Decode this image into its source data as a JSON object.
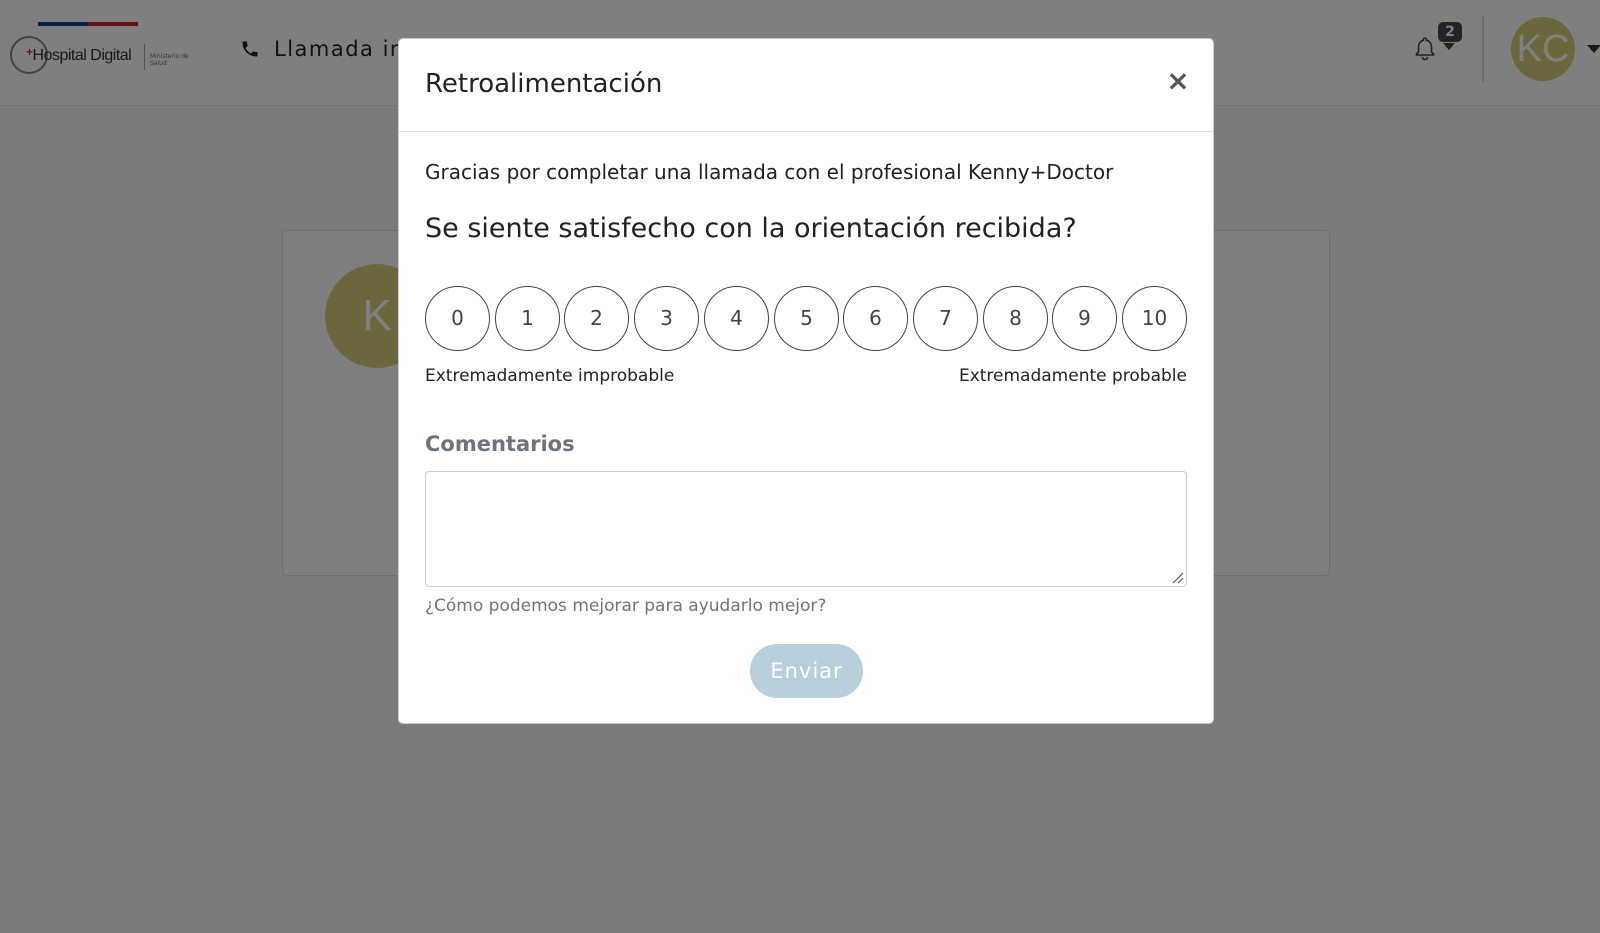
{
  "navbar": {
    "logo_text": "Hospital Digital",
    "logo_ministry": "Ministerio de Salud",
    "call_label": "Llamada in",
    "notification_count": "2",
    "user_initials": "KC",
    "colors": {
      "avatar": "#d9cc7b",
      "badge": "#3d4852",
      "flag_blue": "#0f3f8f",
      "flag_red": "#d1262c"
    }
  },
  "background_card": {
    "avatar_initial": "K"
  },
  "modal": {
    "title": "Retroalimentación",
    "close_symbol": "×",
    "thanks_text": "Gracias por completar una llamada con el profesional Kenny+Doctor",
    "question": "Se siente satisfecho con la orientación recibida?",
    "scale": {
      "options": [
        "0",
        "1",
        "2",
        "3",
        "4",
        "5",
        "6",
        "7",
        "8",
        "9",
        "10"
      ],
      "low_label": "Extremadamente improbable",
      "high_label": "Extremadamente probable"
    },
    "comments": {
      "label": "Comentarios",
      "value": "",
      "help_text": "¿Cómo podemos mejorar para ayudarlo mejor?"
    },
    "submit_label": "Enviar",
    "colors": {
      "submit_bg": "#b8d0db",
      "label_gray": "#6c757d"
    }
  }
}
